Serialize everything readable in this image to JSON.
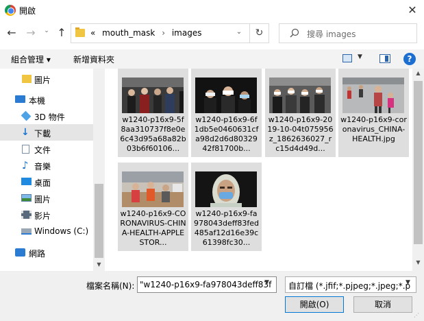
{
  "window": {
    "title": "開啟",
    "close_label": "✕"
  },
  "address_bar": {
    "overflow": "«",
    "segments": [
      "mouth_mask",
      "images"
    ],
    "separator": "›"
  },
  "search": {
    "placeholder": "搜尋 images"
  },
  "toolbar": {
    "organize_label": "組合管理 ▾",
    "new_folder_label": "新增資料夾",
    "help_label": "?"
  },
  "nav": {
    "items": [
      {
        "label": "圖片",
        "icon": "folder-icon"
      },
      {
        "label": "本機",
        "icon": "computer-icon"
      },
      {
        "label": "3D 物件",
        "icon": "3d-objects-icon"
      },
      {
        "label": "下載",
        "icon": "download-icon"
      },
      {
        "label": "文件",
        "icon": "document-icon"
      },
      {
        "label": "音樂",
        "icon": "music-icon"
      },
      {
        "label": "桌面",
        "icon": "desktop-icon"
      },
      {
        "label": "圖片",
        "icon": "pictures-icon"
      },
      {
        "label": "影片",
        "icon": "video-icon"
      },
      {
        "label": "Windows (C:)",
        "icon": "drive-icon"
      },
      {
        "label": "網路",
        "icon": "network-icon"
      }
    ],
    "selected": "下載"
  },
  "files": [
    {
      "name": "w1240-p16x9-5f8aa310737f8e0e6c43d95a68a82b03b6f60106..."
    },
    {
      "name": "w1240-p16x9-6f1db5e0460631cfa98d2d6d8032942f81700b..."
    },
    {
      "name": "w1240-p16x9-2019-10-04t075956z_1862636027_rc15d4d49d..."
    },
    {
      "name": "w1240-p16x9-coronavirus_CHINA-HEALTH.jpg"
    },
    {
      "name": "w1240-p16x9-CORONAVIRUS-CHINA-HEALTH-APPLE STOR..."
    },
    {
      "name": "w1240-p16x9-fa978043deff83fed485af12d16e39c61398fc30..."
    }
  ],
  "bottom": {
    "filename_label": "檔案名稱(N):",
    "filename_value": "\"w1240-p16x9-fa978043deff83f",
    "filter_value": "自訂檔 (*.jfif;*.pjpeg;*.jpeg;*.p",
    "open_label": "開啟(O)",
    "cancel_label": "取消"
  }
}
